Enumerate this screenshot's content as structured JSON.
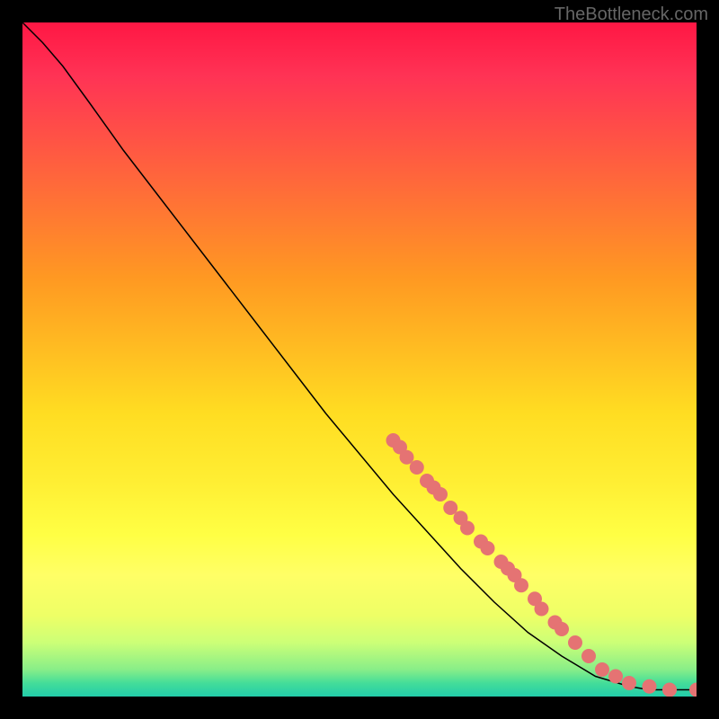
{
  "watermark": "TheBottleneck.com",
  "chart_data": {
    "type": "line",
    "title": "",
    "xlabel": "",
    "ylabel": "",
    "xlim": [
      0,
      100
    ],
    "ylim": [
      0,
      100
    ],
    "line_points": [
      {
        "x": 0,
        "y": 100
      },
      {
        "x": 3,
        "y": 97
      },
      {
        "x": 6,
        "y": 93.5
      },
      {
        "x": 10,
        "y": 88
      },
      {
        "x": 15,
        "y": 81
      },
      {
        "x": 20,
        "y": 74.5
      },
      {
        "x": 25,
        "y": 68
      },
      {
        "x": 30,
        "y": 61.5
      },
      {
        "x": 35,
        "y": 55
      },
      {
        "x": 40,
        "y": 48.5
      },
      {
        "x": 45,
        "y": 42
      },
      {
        "x": 50,
        "y": 36
      },
      {
        "x": 55,
        "y": 30
      },
      {
        "x": 60,
        "y": 24.5
      },
      {
        "x": 65,
        "y": 19
      },
      {
        "x": 70,
        "y": 14
      },
      {
        "x": 75,
        "y": 9.5
      },
      {
        "x": 80,
        "y": 6
      },
      {
        "x": 85,
        "y": 3
      },
      {
        "x": 90,
        "y": 1.5
      },
      {
        "x": 93,
        "y": 1
      },
      {
        "x": 97,
        "y": 1
      },
      {
        "x": 100,
        "y": 1
      }
    ],
    "scatter_points": [
      {
        "x": 55,
        "y": 38
      },
      {
        "x": 56,
        "y": 37
      },
      {
        "x": 57,
        "y": 35.5
      },
      {
        "x": 58.5,
        "y": 34
      },
      {
        "x": 60,
        "y": 32
      },
      {
        "x": 61,
        "y": 31
      },
      {
        "x": 62,
        "y": 30
      },
      {
        "x": 63.5,
        "y": 28
      },
      {
        "x": 65,
        "y": 26.5
      },
      {
        "x": 66,
        "y": 25
      },
      {
        "x": 68,
        "y": 23
      },
      {
        "x": 69,
        "y": 22
      },
      {
        "x": 71,
        "y": 20
      },
      {
        "x": 72,
        "y": 19
      },
      {
        "x": 73,
        "y": 18
      },
      {
        "x": 74,
        "y": 16.5
      },
      {
        "x": 76,
        "y": 14.5
      },
      {
        "x": 77,
        "y": 13
      },
      {
        "x": 79,
        "y": 11
      },
      {
        "x": 80,
        "y": 10
      },
      {
        "x": 82,
        "y": 8
      },
      {
        "x": 84,
        "y": 6
      },
      {
        "x": 86,
        "y": 4
      },
      {
        "x": 88,
        "y": 3
      },
      {
        "x": 90,
        "y": 2
      },
      {
        "x": 93,
        "y": 1.5
      },
      {
        "x": 96,
        "y": 1
      },
      {
        "x": 100,
        "y": 1
      }
    ],
    "scatter_color": "#e57373",
    "line_color": "#000000"
  }
}
